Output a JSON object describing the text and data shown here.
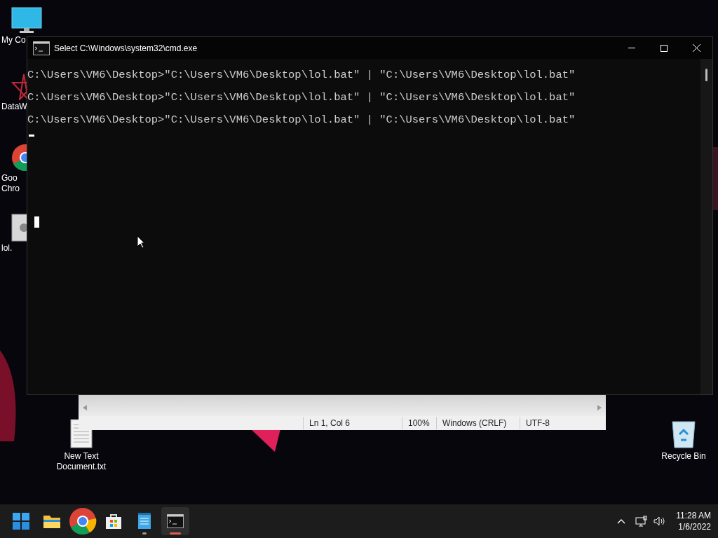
{
  "desktop_icons": [
    {
      "kind": "computer",
      "label": [
        "My Co"
      ]
    },
    {
      "kind": "app",
      "label": [
        "DataW"
      ]
    },
    {
      "kind": "browser",
      "label": [
        "Goo",
        "Chro"
      ]
    },
    {
      "kind": "settings-file",
      "label": [
        "lol."
      ]
    }
  ],
  "desktop_icons_right": [
    {
      "kind": "recycle-bin",
      "label": [
        "Recycle Bin"
      ]
    }
  ],
  "desktop_icons_bottom": [
    {
      "kind": "text-file",
      "label": [
        "New Text",
        "Document.txt"
      ]
    }
  ],
  "notepad": {
    "status_bar": [
      "Ln 1, Col 6",
      "100%",
      "Windows (CRLF)",
      "UTF-8"
    ]
  },
  "cmd_window": {
    "title": "Select C:\\Windows\\system32\\cmd.exe",
    "lines": [
      "C:\\Users\\VM6\\Desktop>\"C:\\Users\\VM6\\Desktop\\lol.bat\" | \"C:\\Users\\VM6\\Desktop\\lol.bat\"",
      "C:\\Users\\VM6\\Desktop>\"C:\\Users\\VM6\\Desktop\\lol.bat\" | \"C:\\Users\\VM6\\Desktop\\lol.bat\"",
      "C:\\Users\\VM6\\Desktop>\"C:\\Users\\VM6\\Desktop\\lol.bat\" | \"C:\\Users\\VM6\\Desktop\\lol.bat\""
    ]
  },
  "taskbar": {
    "apps": [
      {
        "kind": "start",
        "running": false,
        "selected": false
      },
      {
        "kind": "explorer",
        "running": false,
        "selected": false
      },
      {
        "kind": "browser",
        "running": false,
        "selected": false
      },
      {
        "kind": "store",
        "running": false,
        "selected": false
      },
      {
        "kind": "notepad",
        "running": true,
        "selected": false
      },
      {
        "kind": "terminal",
        "running": true,
        "selected": true
      }
    ],
    "time": "11:28 AM",
    "date": "1/6/2022"
  }
}
